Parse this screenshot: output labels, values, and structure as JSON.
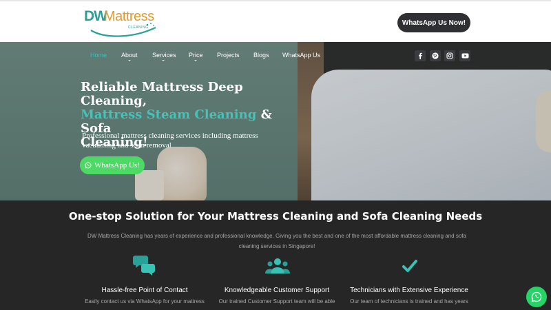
{
  "header": {
    "logo": {
      "mark": "DW",
      "name": "Mattress",
      "tagline": "CLEANING"
    },
    "cta_label": "WhatsApp Us Now!"
  },
  "nav": {
    "items": [
      {
        "label": "Home",
        "active": true,
        "has_dropdown": false
      },
      {
        "label": "About",
        "active": false,
        "has_dropdown": true
      },
      {
        "label": "Services",
        "active": false,
        "has_dropdown": true
      },
      {
        "label": "Price",
        "active": false,
        "has_dropdown": true
      },
      {
        "label": "Projects",
        "active": false,
        "has_dropdown": false
      },
      {
        "label": "Blogs",
        "active": false,
        "has_dropdown": false
      },
      {
        "label": "WhatsApp Us",
        "active": false,
        "has_dropdown": false
      }
    ],
    "social": [
      "facebook-icon",
      "pinterest-icon",
      "instagram-icon",
      "youtube-icon"
    ]
  },
  "hero": {
    "title_line1": "Reliable Mattress Deep Cleaning,",
    "title_highlight": "Mattress Steam Cleaning",
    "title_amp": " & Sofa",
    "title_line3": "Cleaning!",
    "subtitle": "Professional mattress cleaning services including mattress vacuuming and stain removal",
    "button_label": "WhatsApp Us!"
  },
  "intro": {
    "heading": "One-stop Solution for Your Mattress Cleaning and Sofa Cleaning Needs",
    "lead": "DW Mattress Cleaning has years of experience and professional knowledge. Giving you the best and one of the most affordable mattress cleaning and sofa cleaning services in Singapore!"
  },
  "features": [
    {
      "icon": "chat-bubbles-icon",
      "title": "Hassle-free Point of Contact",
      "desc": "Easily contact us via WhatsApp for your mattress"
    },
    {
      "icon": "users-icon",
      "title": "Knowledgeable Customer Support",
      "desc": "Our trained Customer Support team will be able"
    },
    {
      "icon": "checkmark-icon",
      "title": "Technicians with Extensive Experience",
      "desc": "Our team of technicians is trained and has years"
    }
  ],
  "colors": {
    "accent": "#37c2b5",
    "logo_orange": "#e39a2d",
    "whatsapp_green": "#4cd964",
    "dark_bg": "#262626",
    "header_button": "#2e3033"
  }
}
